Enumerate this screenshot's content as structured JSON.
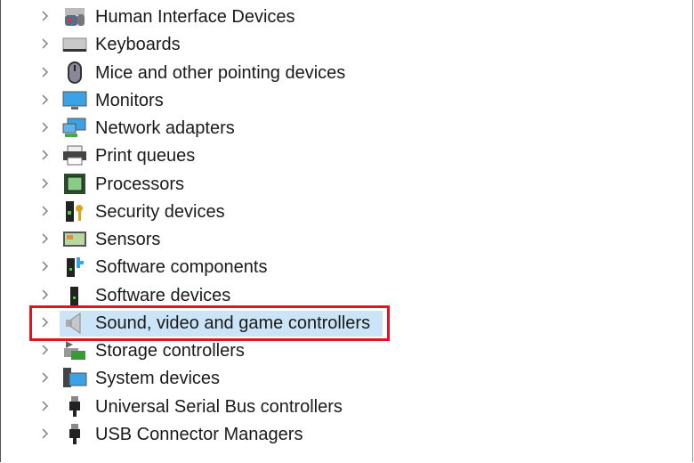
{
  "device_tree": {
    "items": [
      {
        "label": "Human Interface Devices",
        "icon": "hid-icon"
      },
      {
        "label": "Keyboards",
        "icon": "keyboard-icon"
      },
      {
        "label": "Mice and other pointing devices",
        "icon": "mouse-icon"
      },
      {
        "label": "Monitors",
        "icon": "monitor-icon"
      },
      {
        "label": "Network adapters",
        "icon": "network-adapter-icon"
      },
      {
        "label": "Print queues",
        "icon": "printer-icon"
      },
      {
        "label": "Processors",
        "icon": "processor-icon"
      },
      {
        "label": "Security devices",
        "icon": "security-device-icon"
      },
      {
        "label": "Sensors",
        "icon": "sensor-icon"
      },
      {
        "label": "Software components",
        "icon": "software-component-icon"
      },
      {
        "label": "Software devices",
        "icon": "software-device-icon"
      },
      {
        "label": "Sound, video and game controllers",
        "icon": "speaker-icon",
        "selected": true,
        "highlighted": true
      },
      {
        "label": "Storage controllers",
        "icon": "storage-controller-icon"
      },
      {
        "label": "System devices",
        "icon": "system-device-icon"
      },
      {
        "label": "Universal Serial Bus controllers",
        "icon": "usb-icon"
      },
      {
        "label": "USB Connector Managers",
        "icon": "usb-connector-icon"
      }
    ]
  },
  "colors": {
    "selection": "#cce4f7",
    "highlight_box": "#e0141e"
  }
}
